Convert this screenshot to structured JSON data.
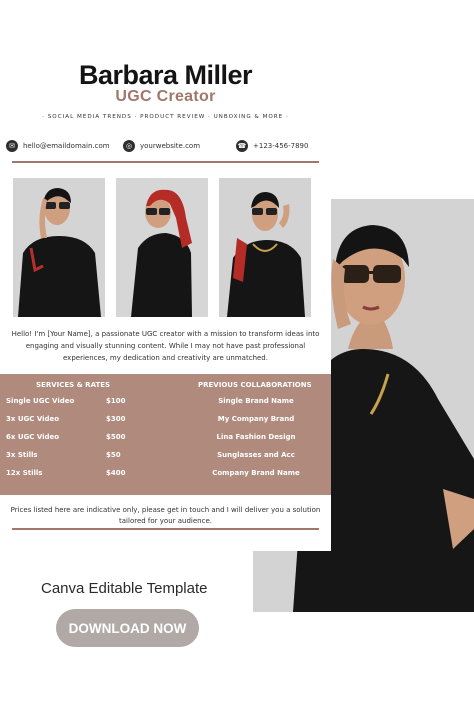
{
  "header": {
    "name": "Barbara Miller",
    "role": "UGC Creator",
    "tagline": "· SOCIAL MEDIA TRENDS · PRODUCT REVIEW · UNBOXING & MORE ·"
  },
  "contacts": {
    "email": "hello@emaildomain.com",
    "website": "yourwebsite.com",
    "phone": "+123-456-7890"
  },
  "photos": [
    "model-photo-1",
    "model-photo-2",
    "model-photo-3",
    "model-hero-photo"
  ],
  "intro": "Hello! I'm [Your Name], a passionate UGC creator with a mission to transform ideas into engaging and visually stunning content. While I may not have past professional experiences, my dedication and creativity are unmatched.",
  "services": {
    "heading": "SERVICES & RATES",
    "items": [
      {
        "name": "Single UGC Video",
        "price": "$100"
      },
      {
        "name": "3x UGC Video",
        "price": "$300"
      },
      {
        "name": "6x UGC Video",
        "price": "$500"
      },
      {
        "name": "3x Stills",
        "price": "$50"
      },
      {
        "name": "12x Stills",
        "price": "$400"
      }
    ]
  },
  "collaborations": {
    "heading": "PREVIOUS COLLABORATIONS",
    "items": [
      "Single Brand Name",
      "My Company Brand",
      "Lina Fashion Design",
      "Sunglasses and Acc",
      "Company Brand Name"
    ]
  },
  "note": "Prices listed here are indicative only, please get in touch and I will deliver you a solution tailored for your audience.",
  "footer": {
    "label": "Canva Editable Template",
    "button": "DOWNLOAD NOW"
  },
  "colors": {
    "accent": "#a0776a",
    "panel": "#b08b7d",
    "button": "#b0a9a6"
  }
}
